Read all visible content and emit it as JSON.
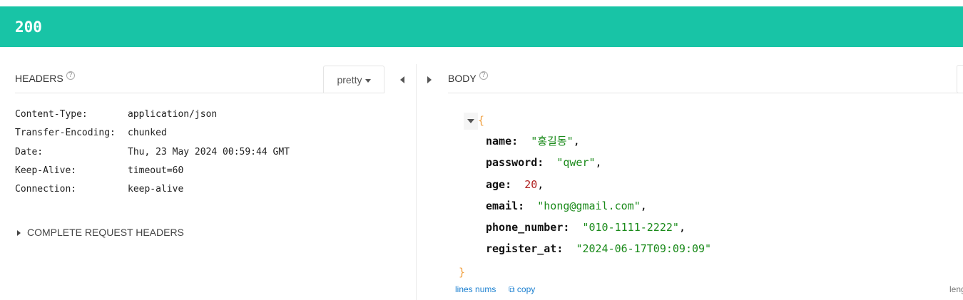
{
  "status": {
    "code": "200",
    "color": "#18c4a6"
  },
  "headers": {
    "title": "HEADERS",
    "help_icon": "?",
    "format_select": "pretty",
    "items": [
      {
        "key": "Content-Type:",
        "value": "application/json"
      },
      {
        "key": "Transfer-Encoding:",
        "value": "chunked"
      },
      {
        "key": "Date:",
        "value": "Thu, 23 May 2024 00:59:44 GMT"
      },
      {
        "key": "Keep-Alive:",
        "value": "timeout=60"
      },
      {
        "key": "Connection:",
        "value": "keep-alive"
      }
    ],
    "complete_request_headers": "COMPLETE REQUEST HEADERS"
  },
  "body": {
    "title": "BODY",
    "help_icon": "?",
    "open_brace": "{",
    "close_brace": "}",
    "fields": [
      {
        "key": "name:",
        "value": "\"홍길동\"",
        "type": "str",
        "comma": ","
      },
      {
        "key": "password:",
        "value": "\"qwer\"",
        "type": "str",
        "comma": ","
      },
      {
        "key": "age:",
        "value": "20",
        "type": "num",
        "comma": ","
      },
      {
        "key": "email:",
        "value": "\"hong@gmail.com\"",
        "type": "str",
        "comma": ","
      },
      {
        "key": "phone_number:",
        "value": "\"010-1111-2222\"",
        "type": "str",
        "comma": ","
      },
      {
        "key": "register_at:",
        "value": "\"2024-06-17T09:09:09\"",
        "type": "str",
        "comma": ""
      }
    ],
    "lines_nums": "lines nums",
    "copy": "copy",
    "length_label": "leng"
  }
}
